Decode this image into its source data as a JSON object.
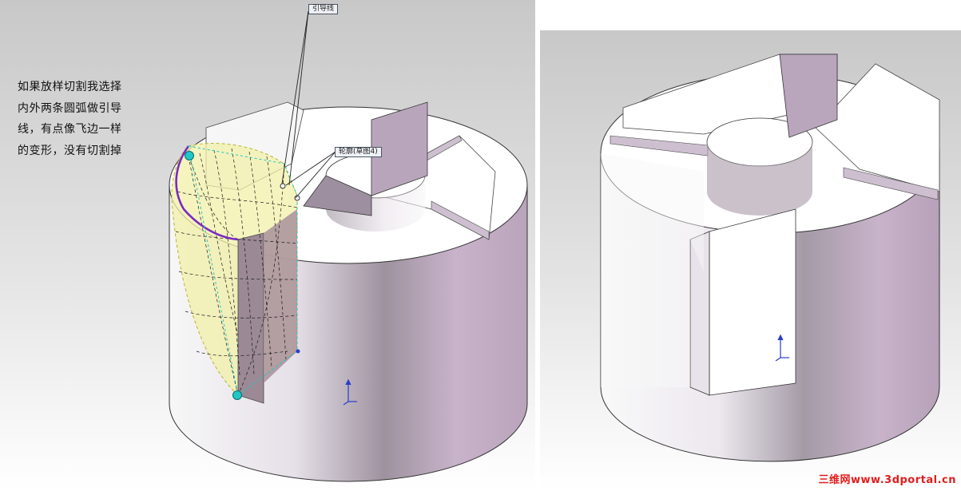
{
  "left_panel": {
    "note_text": "如果放样切割我选择\n内外两条圆弧做引导\n线，有点像飞边一样\n的变形，没有切割掉",
    "callouts": {
      "guide_curve": "引导线",
      "profile": "轮廓(草图4)"
    }
  },
  "watermark": "三维网www.3dportal.cn",
  "colors": {
    "viewport_gradient_light": "#ffffff",
    "viewport_gradient_dark": "#c2c2c2",
    "part_face_white": "#ffffff",
    "part_side_lilac": "#c6aec8",
    "guide_curve_purple": "#7a2bbf",
    "preview_yellow": "#f2f0a8",
    "selection_teal": "#21c7c7",
    "triad_blue": "#2a3dcc",
    "watermark_red": "#e11d1d"
  },
  "icons": [
    "triad-icon",
    "endpoint-handle-icon"
  ]
}
